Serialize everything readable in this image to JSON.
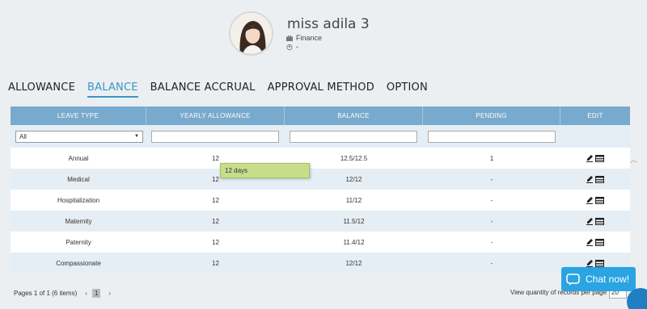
{
  "profile": {
    "name": "miss adila 3",
    "department": "Finance",
    "sub": "-",
    "avatar_icon": "user-photo"
  },
  "tabs": [
    {
      "label": "ALLOWANCE",
      "active": false
    },
    {
      "label": "BALANCE",
      "active": true
    },
    {
      "label": "BALANCE ACCRUAL",
      "active": false
    },
    {
      "label": "APPROVAL METHOD",
      "active": false
    },
    {
      "label": "OPTION",
      "active": false
    }
  ],
  "table": {
    "headers": [
      "LEAVE TYPE",
      "YEARLY ALLOWANCE",
      "BALANCE",
      "PENDING",
      "EDIT"
    ],
    "filter_select": "All",
    "rows": [
      {
        "type": "Annual",
        "allowance": "12",
        "balance": "12.5/12.5",
        "pending": "1"
      },
      {
        "type": "Medical",
        "allowance": "12",
        "balance": "12/12",
        "pending": "-"
      },
      {
        "type": "Hospitalization",
        "allowance": "12",
        "balance": "11/12",
        "pending": "-"
      },
      {
        "type": "Maternity",
        "allowance": "12",
        "balance": "11.5/12",
        "pending": "-"
      },
      {
        "type": "Paternity",
        "allowance": "12",
        "balance": "11.4/12",
        "pending": "-"
      },
      {
        "type": "Compassionate",
        "allowance": "12",
        "balance": "12/12",
        "pending": "-"
      }
    ]
  },
  "tooltip": "12 days",
  "pager": {
    "text": "Pages 1 of 1 (6 items)",
    "prev": "‹",
    "page": "1",
    "next": "›"
  },
  "records": {
    "label": "View quantity of records per page",
    "value": "20"
  },
  "chat": {
    "label": "Chat now!"
  },
  "colors": {
    "header_bg": "#78aacd",
    "active_tab": "#3a95c9",
    "tooltip_bg": "#c6dd8a",
    "chat_bg": "#2aa4e2"
  }
}
